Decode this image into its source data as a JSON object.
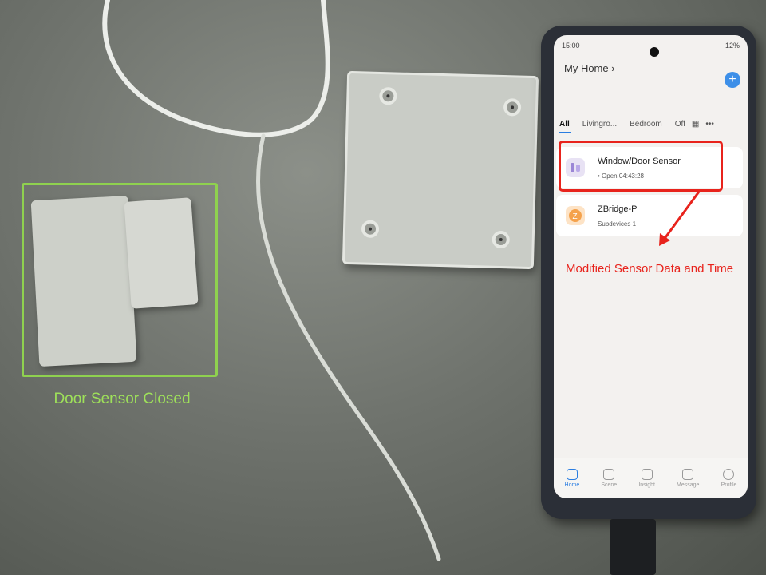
{
  "sensor_caption": "Door Sensor Closed",
  "annotation": "Modified Sensor Data and Time",
  "phone": {
    "status_time": "15:00",
    "status_right": "12%",
    "home_title": "My Home",
    "tabs": [
      "All",
      "Livingro...",
      "Bedroom",
      "Off"
    ],
    "devices": [
      {
        "name": "Window/Door Sensor",
        "status": "Open 04:43:28"
      },
      {
        "name": "ZBridge-P",
        "status": "Subdevices 1"
      }
    ],
    "nav": [
      "Home",
      "Scene",
      "Insight",
      "Message",
      "Profile"
    ]
  },
  "colors": {
    "sensor_highlight": "#8fd14f",
    "annotation": "#e8231c",
    "app_accent": "#2a7de1"
  }
}
